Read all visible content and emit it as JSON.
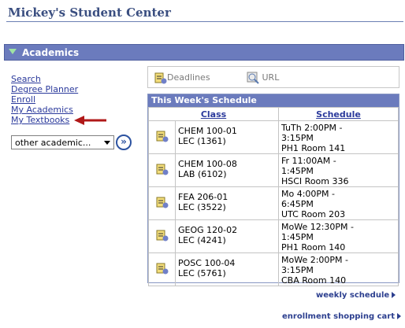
{
  "page": {
    "title": "Mickey's Student Center"
  },
  "section": {
    "title": "Academics"
  },
  "nav": {
    "items": [
      "Search",
      "Degree Planner",
      "Enroll",
      "My Academics",
      "My Textbooks"
    ]
  },
  "other_select": {
    "value": "other academic..."
  },
  "toolbar": {
    "deadlines": "Deadlines",
    "url": "URL"
  },
  "schedule": {
    "title": "This Week's Schedule",
    "col_class": "Class",
    "col_schedule": "Schedule",
    "rows": [
      {
        "class1": "CHEM 100-01",
        "class2": "LEC (1361)",
        "s1": "TuTh 2:00PM -",
        "s2": "3:15PM",
        "s3": "PH1  Room 141"
      },
      {
        "class1": "CHEM 100-08",
        "class2": "LAB (6102)",
        "s1": "Fr 11:00AM -",
        "s2": "1:45PM",
        "s3": "HSCI Room 336"
      },
      {
        "class1": "FEA 206-01",
        "class2": "LEC (3522)",
        "s1": "Mo 4:00PM -",
        "s2": "6:45PM",
        "s3": "UTC  Room 203"
      },
      {
        "class1": "GEOG 120-02",
        "class2": "LEC (4241)",
        "s1": "MoWe 12:30PM -",
        "s2": "1:45PM",
        "s3": "PH1  Room 140"
      },
      {
        "class1": "POSC 100-04",
        "class2": "LEC (5761)",
        "s1": "MoWe 2:00PM -",
        "s2": "3:15PM",
        "s3": "CBA  Room 140"
      }
    ]
  },
  "links": {
    "weekly": "weekly schedule",
    "cart": "enrollment shopping cart"
  },
  "colors": {
    "header_bar": "#6b7bbd",
    "link": "#2b3a9c",
    "arrow": "#b01818"
  }
}
